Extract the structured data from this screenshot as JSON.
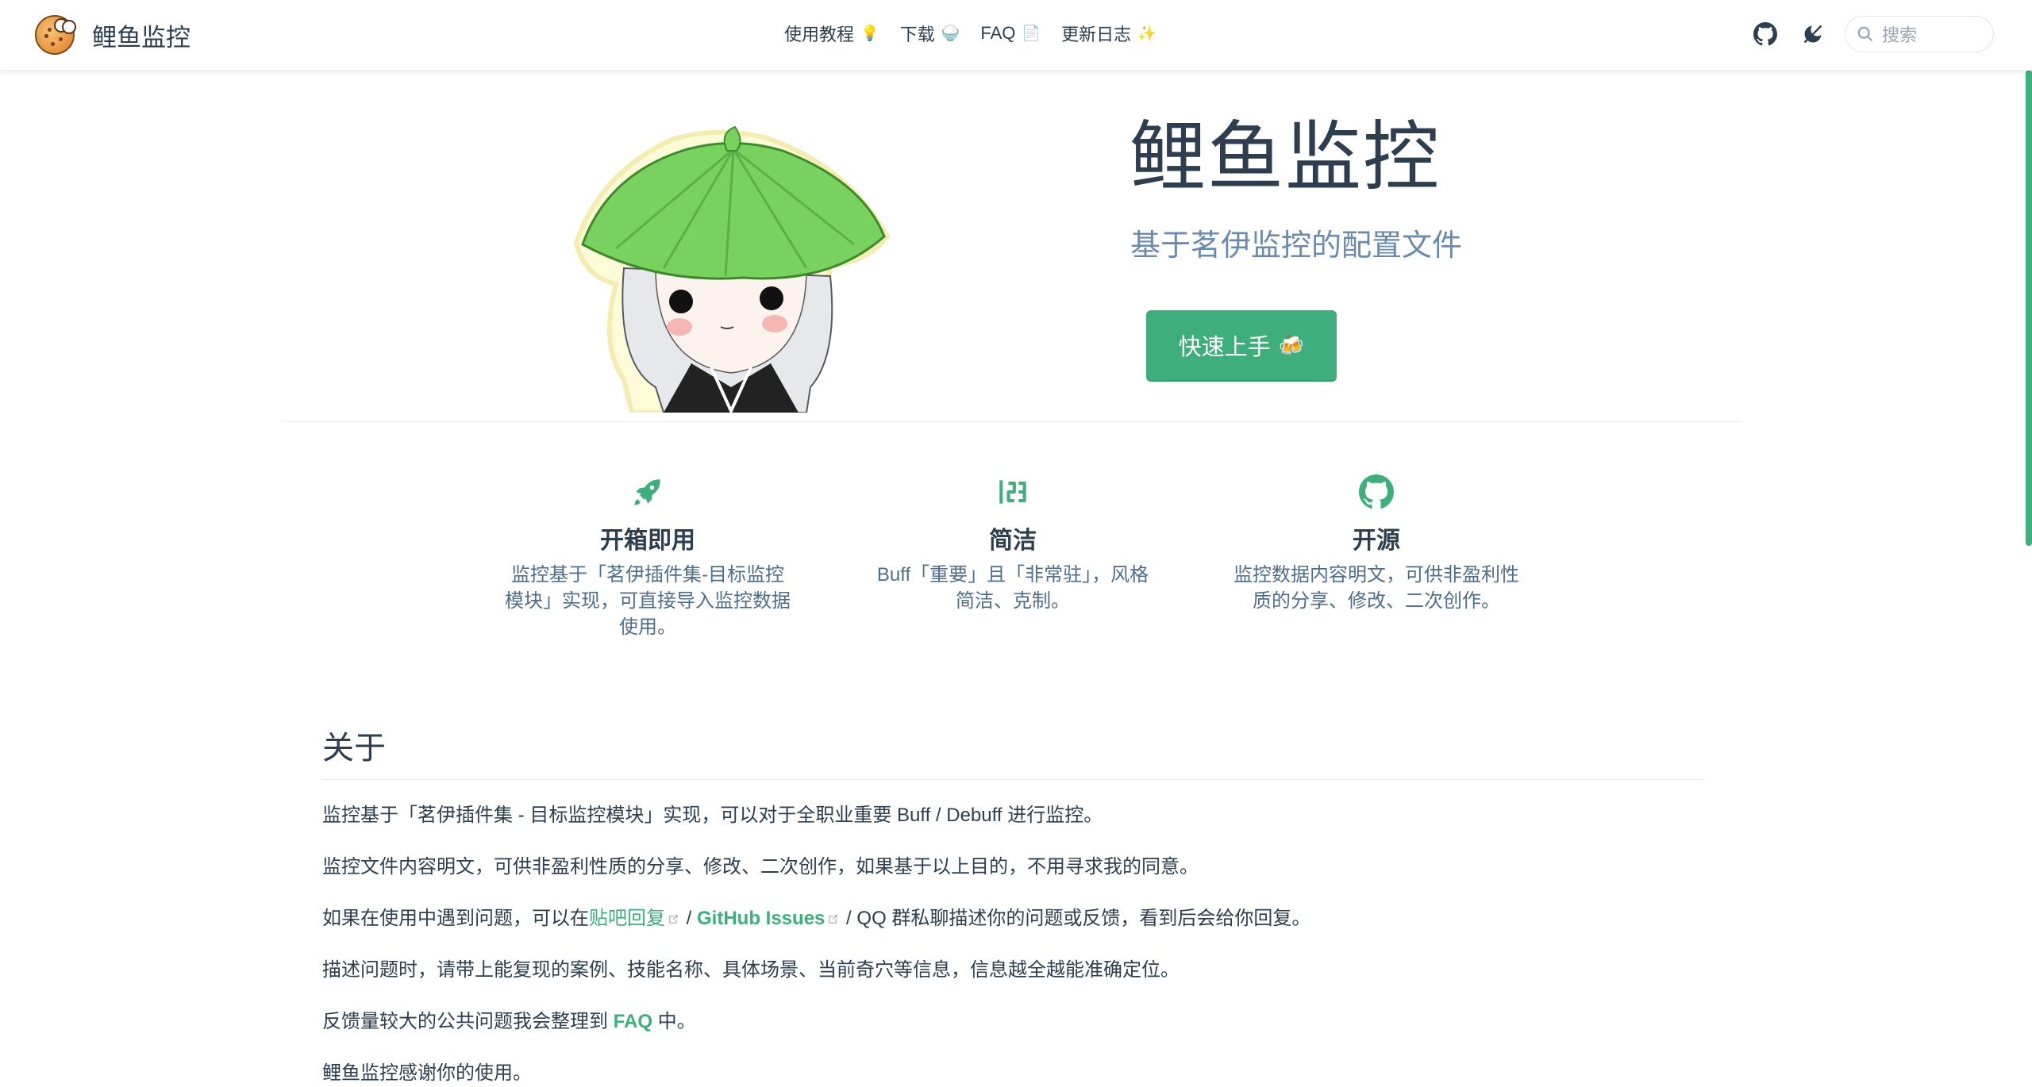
{
  "brand": {
    "title": "鲤鱼监控"
  },
  "nav": {
    "links": [
      {
        "label": "使用教程",
        "emoji": "💡"
      },
      {
        "label": "下载",
        "emoji": "🍚"
      },
      {
        "label": "FAQ",
        "emoji": "📄"
      },
      {
        "label": "更新日志",
        "emoji": "✨"
      }
    ],
    "right_icons": [
      "github-icon",
      "theme-toggle-icon",
      "search-icon"
    ],
    "search_placeholder": "搜索"
  },
  "hero": {
    "title": "鲤鱼监控",
    "description": "基于茗伊监控的配置文件",
    "action_label": "快速上手",
    "action_emoji": "🍻"
  },
  "features": [
    {
      "icon": "rocket-icon",
      "title": "开箱即用",
      "lines": [
        "监控基于「茗伊插件集-目标监控",
        "模块」实现，可直接导入监控数据",
        "使用。"
      ]
    },
    {
      "icon": "numbers-icon",
      "title": "简洁",
      "lines": [
        "Buff「重要」且「非常驻」，风格",
        "简洁、克制。"
      ]
    },
    {
      "icon": "github-icon",
      "title": "开源",
      "lines": [
        "监控数据内容明文，可供非盈利性",
        "质的分享、修改、二次创作。"
      ]
    }
  ],
  "about": {
    "heading": "关于",
    "p1": "监控基于「茗伊插件集 - 目标监控模块」实现，可以对于全职业重要 Buff / Debuff 进行监控。",
    "p2": "监控文件内容明文，可供非盈利性质的分享、修改、二次创作，如果基于以上目的，不用寻求我的同意。",
    "p3_before": "如果在使用中遇到问题，可以在",
    "p3_link1": "贴吧回复",
    "p3_sep": " / ",
    "p3_link2": "GitHub Issues",
    "p3_after": " / QQ 群私聊描述你的问题或反馈，看到后会给你回复。",
    "p4": "描述问题时，请带上能复现的案例、技能名称、具体场景、当前奇穴等信息，信息越全越能准确定位。",
    "p5_before": "反馈量较大的公共问题我会整理到 ",
    "p5_link": "FAQ",
    "p5_after": " 中。",
    "p6": "鲤鱼监控感谢你的使用。"
  },
  "colors": {
    "accent": "#3eaf7c",
    "text": "#2c3e50",
    "muted": "#6a8bad"
  }
}
